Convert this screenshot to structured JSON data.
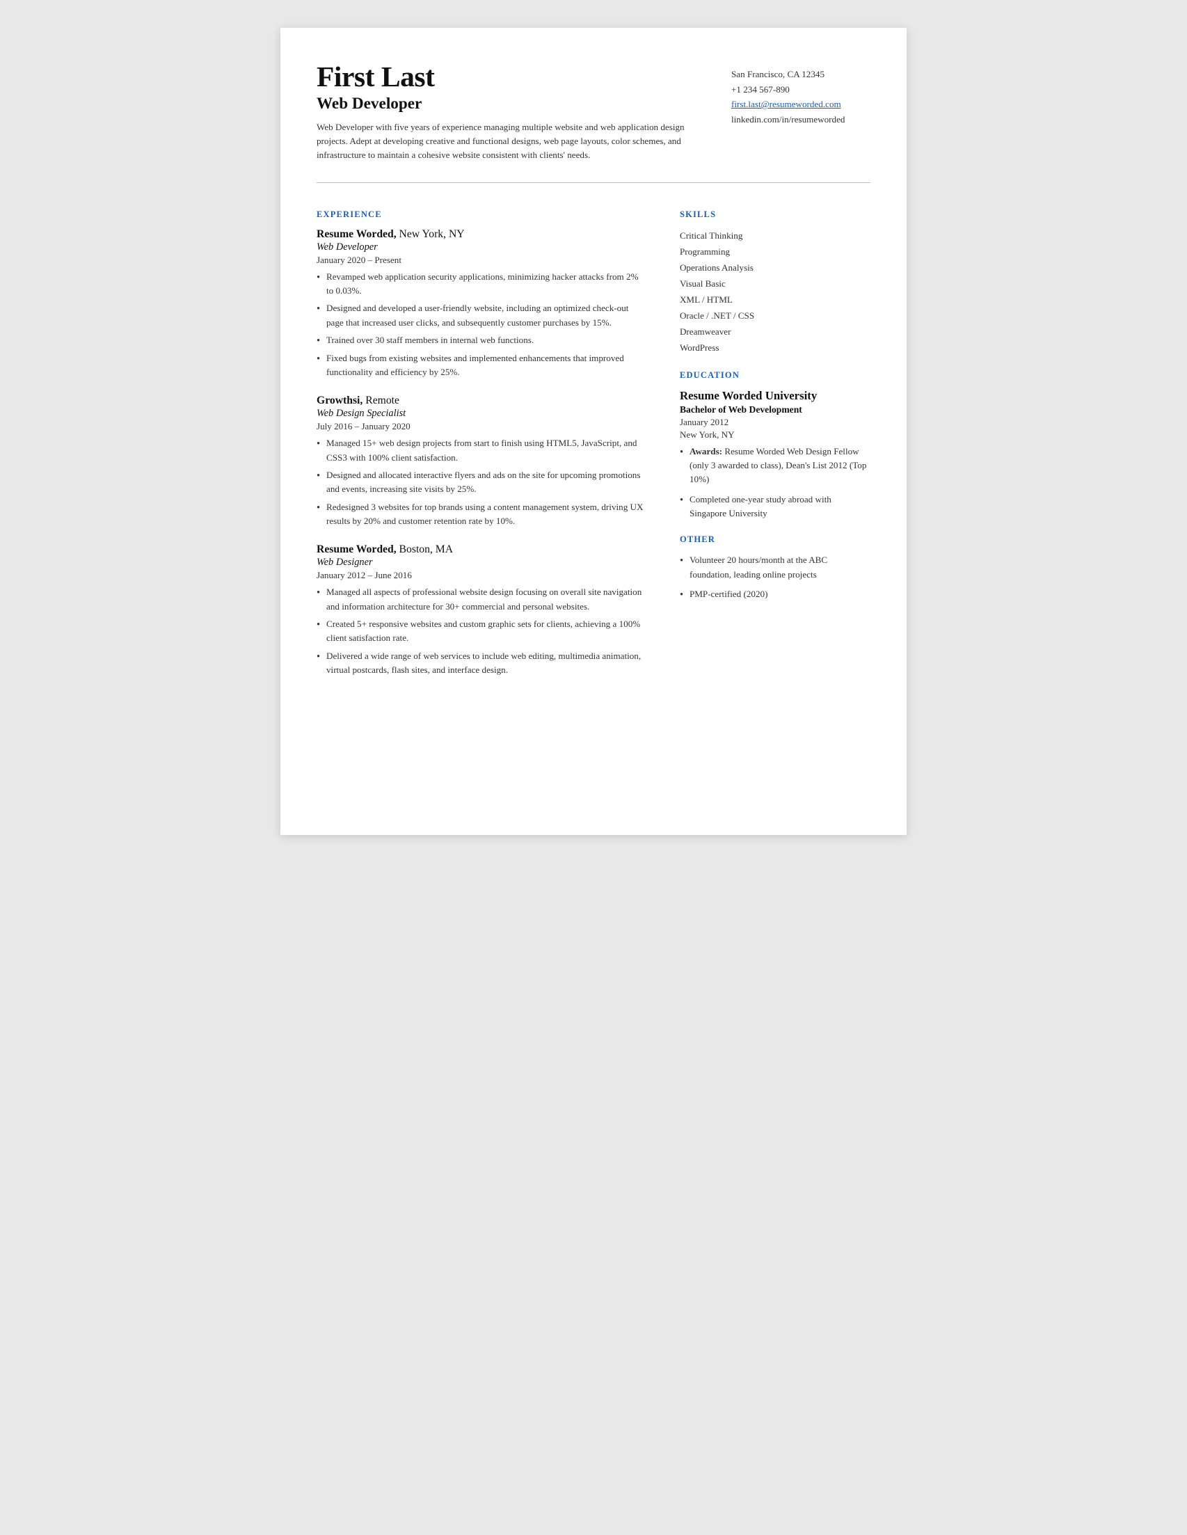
{
  "header": {
    "name": "First Last",
    "title": "Web Developer",
    "summary": "Web Developer with five years of experience managing multiple website and web application design projects. Adept at developing creative and functional designs, web page layouts, color schemes, and infrastructure to maintain a cohesive website consistent with clients' needs.",
    "contact": {
      "location": "San Francisco, CA 12345",
      "phone": "+1 234 567-890",
      "email": "first.last@resumeworded.com",
      "linkedin": "linkedin.com/in/resumeworded"
    }
  },
  "sections": {
    "experience_label": "EXPERIENCE",
    "skills_label": "SKILLS",
    "education_label": "EDUCATION",
    "other_label": "OTHER"
  },
  "experience": [
    {
      "company": "Resume Worded,",
      "location": " New York, NY",
      "role": "Web Developer",
      "dates": "January 2020 – Present",
      "bullets": [
        "Revamped web application security applications, minimizing hacker attacks from 2% to 0.03%.",
        "Designed and developed a user-friendly website, including an optimized check-out page that increased user clicks, and subsequently customer purchases by 15%.",
        "Trained over 30 staff members in internal web functions.",
        "Fixed bugs from existing websites and implemented enhancements that improved functionality and efficiency by 25%."
      ]
    },
    {
      "company": "Growthsi,",
      "location": " Remote",
      "role": "Web Design Specialist",
      "dates": "July 2016 – January 2020",
      "bullets": [
        "Managed 15+ web design projects from start to finish using HTML5, JavaScript, and CSS3 with 100% client satisfaction.",
        "Designed and allocated interactive flyers and ads on the site for upcoming promotions and events, increasing site visits by 25%.",
        "Redesigned 3 websites for top brands using a content management system, driving UX results by 20% and customer retention rate by 10%."
      ]
    },
    {
      "company": "Resume Worded,",
      "location": " Boston, MA",
      "role": "Web Designer",
      "dates": "January 2012 – June 2016",
      "bullets": [
        "Managed all aspects of professional website design focusing on overall site navigation and information architecture for 30+ commercial and personal websites.",
        "Created 5+ responsive websites and custom graphic sets for clients, achieving a 100% client satisfaction rate.",
        "Delivered a wide range of web services to include web editing, multimedia animation, virtual postcards, flash sites, and interface design."
      ]
    }
  ],
  "skills": [
    "Critical Thinking",
    "Programming",
    "Operations Analysis",
    "Visual Basic",
    "XML / HTML",
    "Oracle / .NET / CSS",
    "Dreamweaver",
    "WordPress"
  ],
  "education": {
    "school": "Resume Worded University",
    "degree": "Bachelor of Web Development",
    "date": "January 2012",
    "location": "New York, NY",
    "bullets": [
      {
        "label": "Awards:",
        "text": " Resume Worded Web Design Fellow (only 3 awarded to class), Dean's List 2012 (Top 10%)"
      },
      {
        "label": "",
        "text": "Completed one-year study abroad with Singapore University"
      }
    ]
  },
  "other": [
    "Volunteer 20 hours/month at the ABC foundation, leading online projects",
    "PMP-certified (2020)"
  ]
}
